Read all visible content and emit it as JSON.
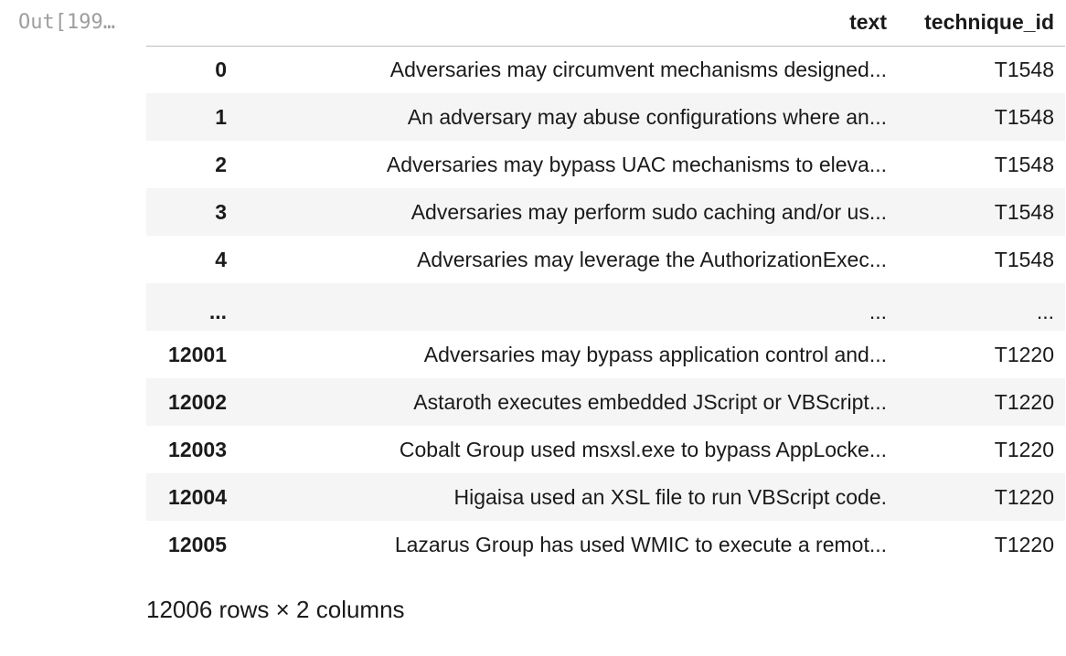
{
  "output_prompt": "Out[199…",
  "dataframe": {
    "columns": [
      "",
      "text",
      "technique_id"
    ],
    "rows": [
      {
        "index": "0",
        "text": "Adversaries may circumvent mechanisms designed...",
        "technique_id": "T1548"
      },
      {
        "index": "1",
        "text": "An adversary may abuse configurations where an...",
        "technique_id": "T1548"
      },
      {
        "index": "2",
        "text": "Adversaries may bypass UAC mechanisms to eleva...",
        "technique_id": "T1548"
      },
      {
        "index": "3",
        "text": "Adversaries may perform sudo caching and/or us...",
        "technique_id": "T1548"
      },
      {
        "index": "4",
        "text": "Adversaries may leverage the AuthorizationExec...",
        "technique_id": "T1548"
      },
      {
        "index": "...",
        "text": "...",
        "technique_id": "..."
      },
      {
        "index": "12001",
        "text": "Adversaries may bypass application control and...",
        "technique_id": "T1220"
      },
      {
        "index": "12002",
        "text": "Astaroth executes embedded JScript or VBScript...",
        "technique_id": "T1220"
      },
      {
        "index": "12003",
        "text": "Cobalt Group used msxsl.exe to bypass AppLocke...",
        "technique_id": "T1220"
      },
      {
        "index": "12004",
        "text": "Higaisa used an XSL file to run VBScript code.",
        "technique_id": "T1220"
      },
      {
        "index": "12005",
        "text": "Lazarus Group has used WMIC to execute a remot...",
        "technique_id": "T1220"
      }
    ],
    "summary": "12006 rows × 2 columns"
  }
}
